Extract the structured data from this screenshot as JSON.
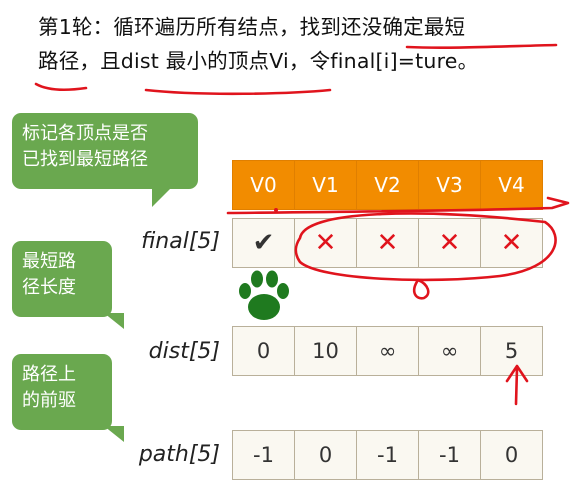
{
  "heading": {
    "line1": "第1轮：循环遍历所有结点，找到还没确定最短",
    "line2": "路径，且dist 最小的顶点Vi，令final[i]=ture。"
  },
  "callouts": [
    {
      "lines": [
        "标记各顶点是否",
        "已找到最短路径"
      ]
    },
    {
      "lines": [
        "最短路",
        "径长度"
      ]
    },
    {
      "lines": [
        "路径上",
        "的前驱"
      ]
    }
  ],
  "headers": [
    "V0",
    "V1",
    "V2",
    "V3",
    "V4"
  ],
  "rows": [
    {
      "label": "final[5]",
      "cells": [
        "✔",
        "✕",
        "✕",
        "✕",
        "✕"
      ]
    },
    {
      "label": "dist[5]",
      "cells": [
        "0",
        "10",
        "∞",
        "∞",
        "5"
      ]
    },
    {
      "label": "path[5]",
      "cells": [
        "-1",
        "0",
        "-1",
        "-1",
        "0"
      ]
    }
  ],
  "colors": {
    "header_bg": "#f28c00",
    "callout_bg": "#6aa84f",
    "annotation_red": "#e0141d",
    "paw_green": "#1f7a1f"
  },
  "icons": [
    "paw-icon"
  ]
}
